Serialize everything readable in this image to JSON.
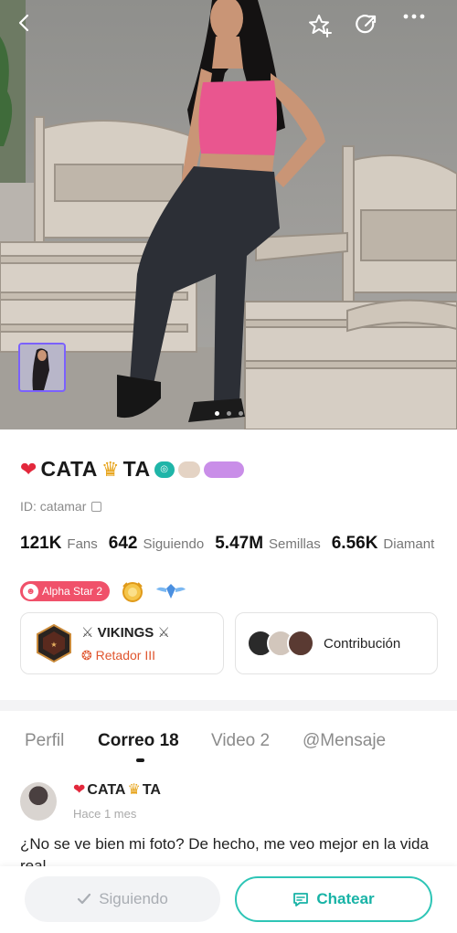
{
  "header": {
    "back_icon": "chevron-left-icon",
    "actions": [
      "star-add-icon",
      "share-icon",
      "more-icon"
    ]
  },
  "hero": {
    "pagination": {
      "total": 3,
      "active": 1
    }
  },
  "profile": {
    "name": "CATA",
    "name_tail": "TA",
    "name_emoji_left": "❤️‍🔥",
    "name_emoji_mid": "👑",
    "id_label": "ID: catamar",
    "stats": [
      {
        "value": "121K",
        "label": "Fans"
      },
      {
        "value": "642",
        "label": "Siguiendo"
      },
      {
        "value": "5.47M",
        "label": "Semillas"
      },
      {
        "value": "6.56K",
        "label": "Diamant"
      }
    ],
    "alpha_badge": "Alpha Star 2",
    "family": {
      "name": "VIKINGS",
      "rank": "Retador III"
    },
    "contribution_label": "Contribución"
  },
  "tabs": [
    {
      "label": "Perfil",
      "active": false
    },
    {
      "label": "Correo 18",
      "active": true
    },
    {
      "label": "Video 2",
      "active": false
    },
    {
      "label": "@Mensaje",
      "active": false
    }
  ],
  "post": {
    "author": "CATA",
    "author_tail": "TA",
    "time": "Hace 1 mes",
    "text": "¿No se ve bien mi foto? De hecho, me veo mejor en la vida real"
  },
  "actions": {
    "follow_label": "Siguiendo",
    "chat_label": "Chatear"
  },
  "colors": {
    "accent": "#2ec5b6",
    "alpha": "#f0516a",
    "rank": "#e0562f"
  }
}
